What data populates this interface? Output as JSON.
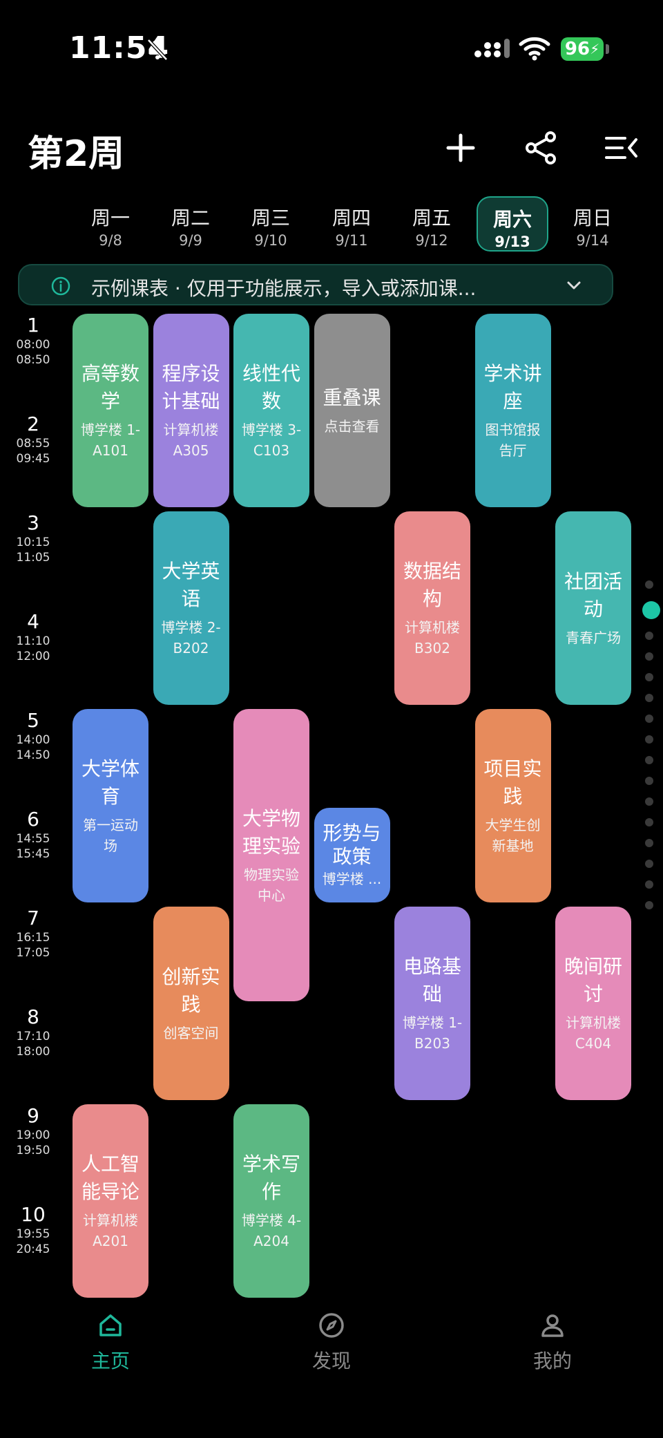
{
  "status": {
    "time": "11:54",
    "battery": "96"
  },
  "header": {
    "week_title": "第2周"
  },
  "days": [
    {
      "name": "周一",
      "date": "9/8"
    },
    {
      "name": "周二",
      "date": "9/9"
    },
    {
      "name": "周三",
      "date": "9/10"
    },
    {
      "name": "周四",
      "date": "9/11"
    },
    {
      "name": "周五",
      "date": "9/12"
    },
    {
      "name": "周六",
      "date": "9/13",
      "selected": true
    },
    {
      "name": "周日",
      "date": "9/14"
    }
  ],
  "notice": {
    "text": "示例课表 · 仅用于功能展示，导入或添加课..."
  },
  "periods": [
    {
      "num": "1",
      "start": "08:00",
      "end": "08:50"
    },
    {
      "num": "2",
      "start": "08:55",
      "end": "09:45"
    },
    {
      "num": "3",
      "start": "10:15",
      "end": "11:05"
    },
    {
      "num": "4",
      "start": "11:10",
      "end": "12:00"
    },
    {
      "num": "5",
      "start": "14:00",
      "end": "14:50"
    },
    {
      "num": "6",
      "start": "14:55",
      "end": "15:45"
    },
    {
      "num": "7",
      "start": "16:15",
      "end": "17:05"
    },
    {
      "num": "8",
      "start": "17:10",
      "end": "18:00"
    },
    {
      "num": "9",
      "start": "19:00",
      "end": "19:50"
    },
    {
      "num": "10",
      "start": "19:55",
      "end": "20:45"
    }
  ],
  "courses": [
    {
      "name": "高等数学",
      "location": "博学楼 1-A101",
      "day": 1,
      "start": 1,
      "span": 2,
      "color": "#5cb883"
    },
    {
      "name": "程序设计基础",
      "location": "计算机楼A305",
      "day": 2,
      "start": 1,
      "span": 2,
      "color": "#9b82dd"
    },
    {
      "name": "线性代数",
      "location": "博学楼 3-C103",
      "day": 3,
      "start": 1,
      "span": 2,
      "color": "#45b7b0"
    },
    {
      "name": "重叠课",
      "location": "点击查看",
      "day": 4,
      "start": 1,
      "span": 2,
      "color": "#8e8e8e"
    },
    {
      "name": "学术讲座",
      "location": "图书馆报告厅",
      "day": 6,
      "start": 1,
      "span": 2,
      "color": "#3aa9b5"
    },
    {
      "name": "大学英语",
      "location": "博学楼 2-B202",
      "day": 2,
      "start": 3,
      "span": 2,
      "color": "#3aa9b5"
    },
    {
      "name": "数据结构",
      "location": "计算机楼B302",
      "day": 5,
      "start": 3,
      "span": 2,
      "color": "#e98b8c"
    },
    {
      "name": "社团活动",
      "location": "青春广场",
      "day": 7,
      "start": 3,
      "span": 2,
      "color": "#45b7b0"
    },
    {
      "name": "大学体育",
      "location": "第一运动场",
      "day": 1,
      "start": 5,
      "span": 2,
      "color": "#5b87e4"
    },
    {
      "name": "大学物理实验",
      "location": "物理实验中心",
      "day": 3,
      "start": 5,
      "span": 3,
      "color": "#e58bb9"
    },
    {
      "name": "形势与政策",
      "location": "博学楼 ...",
      "day": 4,
      "start": 6,
      "span": 1,
      "color": "#5b87e4"
    },
    {
      "name": "项目实践",
      "location": "大学生创新基地",
      "day": 6,
      "start": 5,
      "span": 2,
      "color": "#e78b5c"
    },
    {
      "name": "创新实践",
      "location": "创客空间",
      "day": 2,
      "start": 7,
      "span": 2,
      "color": "#e78b5c"
    },
    {
      "name": "电路基础",
      "location": "博学楼 1-B203",
      "day": 5,
      "start": 7,
      "span": 2,
      "color": "#9b82dd"
    },
    {
      "name": "晚间研讨",
      "location": "计算机楼C404",
      "day": 7,
      "start": 7,
      "span": 2,
      "color": "#e58bb9"
    },
    {
      "name": "人工智能导论",
      "location": "计算机楼A201",
      "day": 1,
      "start": 9,
      "span": 2,
      "color": "#e98b8c"
    },
    {
      "name": "学术写作",
      "location": "博学楼 4-A204",
      "day": 3,
      "start": 9,
      "span": 2,
      "color": "#5cb883"
    }
  ],
  "tabs": [
    {
      "label": "主页",
      "icon": "home-icon",
      "active": true
    },
    {
      "label": "发现",
      "icon": "compass-icon"
    },
    {
      "label": "我的",
      "icon": "person-icon"
    }
  ],
  "accent_color": "#1fb89b"
}
